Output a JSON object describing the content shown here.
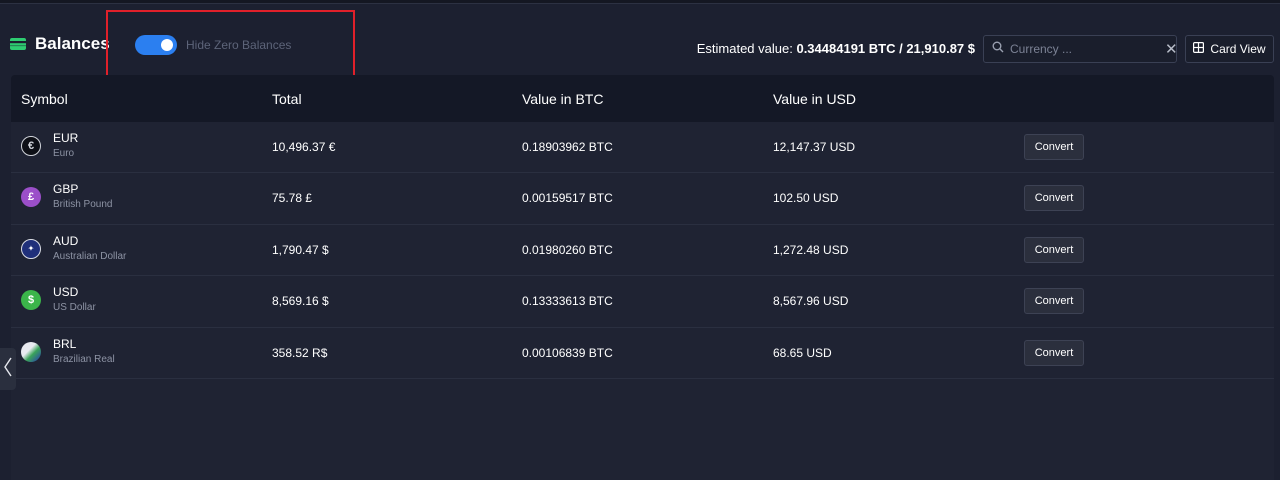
{
  "header": {
    "title": "Balances",
    "title_icon": "wallet-icon",
    "toggle_label": "Hide Zero Balances",
    "toggle_on": true,
    "estimated_label": "Estimated value:",
    "estimated_value": "0.34484191 BTC / 21,910.87 $",
    "search_placeholder": "Currency ...",
    "card_view_label": "Card View"
  },
  "colors": {
    "accent": "#2b7ff0",
    "highlight": "#e0202a",
    "background": "#1c2030"
  },
  "table": {
    "columns": [
      "Symbol",
      "Total",
      "Value in BTC",
      "Value in USD"
    ],
    "rows": [
      {
        "code": "EUR",
        "name": "Euro",
        "total": "10,496.37 €",
        "btc": "0.18903962 BTC",
        "usd": "12,147.37 USD",
        "action": "Convert",
        "icon": "euro-coin-icon"
      },
      {
        "code": "GBP",
        "name": "British Pound",
        "total": "75.78 £",
        "btc": "0.00159517 BTC",
        "usd": "102.50 USD",
        "action": "Convert",
        "icon": "pound-coin-icon"
      },
      {
        "code": "AUD",
        "name": "Australian Dollar",
        "total": "1,790.47 $",
        "btc": "0.01980260 BTC",
        "usd": "1,272.48 USD",
        "action": "Convert",
        "icon": "australia-flag-icon"
      },
      {
        "code": "USD",
        "name": "US Dollar",
        "total": "8,569.16 $",
        "btc": "0.13333613 BTC",
        "usd": "8,567.96 USD",
        "action": "Convert",
        "icon": "dollar-coin-icon"
      },
      {
        "code": "BRL",
        "name": "Brazilian Real",
        "total": "358.52 R$",
        "btc": "0.00106839 BTC",
        "usd": "68.65 USD",
        "action": "Convert",
        "icon": "brazil-flag-icon"
      }
    ]
  }
}
